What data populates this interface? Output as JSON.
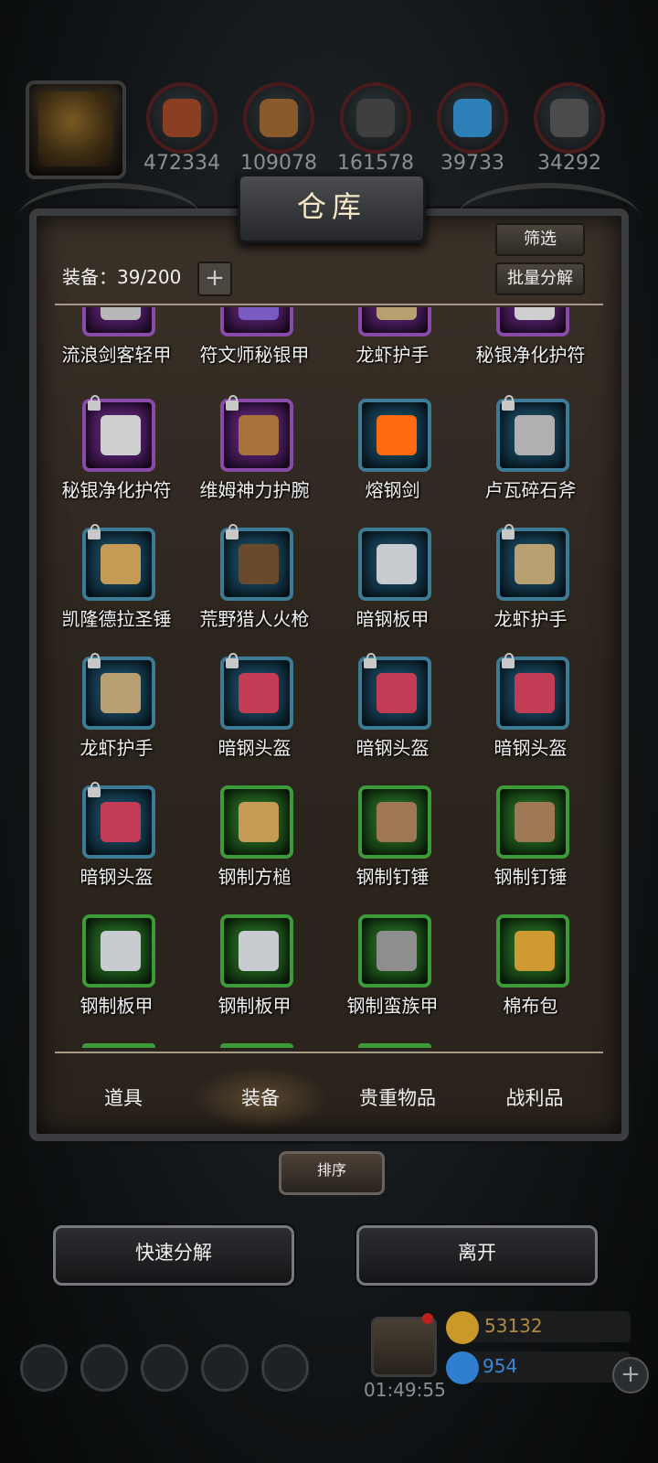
{
  "header": {
    "resources": [
      {
        "icon": "meat-icon",
        "value": "472334"
      },
      {
        "icon": "wood-icon",
        "value": "109078"
      },
      {
        "icon": "stone-icon",
        "value": "161578"
      },
      {
        "icon": "crystal-icon",
        "value": "39733"
      },
      {
        "icon": "iron-icon",
        "value": "34292"
      }
    ]
  },
  "panel": {
    "title": "仓库",
    "capacity_label": "装备：39/200",
    "filter_label": "筛选",
    "batch_label": "批量分解"
  },
  "items": [
    {
      "name": "流浪剑客轻甲",
      "rarity": "purple",
      "locked": false,
      "row": 0,
      "col": 0,
      "color": "#b8b8b8"
    },
    {
      "name": "符文师秘银甲",
      "rarity": "purple",
      "locked": false,
      "row": 0,
      "col": 1,
      "color": "#7a5bc4"
    },
    {
      "name": "龙虾护手",
      "rarity": "purple",
      "locked": false,
      "row": 0,
      "col": 2,
      "color": "#b8a070"
    },
    {
      "name": "秘银净化护符",
      "rarity": "purple",
      "locked": false,
      "row": 0,
      "col": 3,
      "color": "#cfcfcf"
    },
    {
      "name": "秘银净化护符",
      "rarity": "purple",
      "locked": true,
      "row": 1,
      "col": 0,
      "color": "#cfcfcf"
    },
    {
      "name": "维姆神力护腕",
      "rarity": "purple",
      "locked": true,
      "row": 1,
      "col": 1,
      "color": "#a8733a"
    },
    {
      "name": "熔钢剑",
      "rarity": "blue",
      "locked": false,
      "row": 1,
      "col": 2,
      "color": "#ff6a12"
    },
    {
      "name": "卢瓦碎石斧",
      "rarity": "blue",
      "locked": true,
      "row": 1,
      "col": 3,
      "color": "#b0b0b0"
    },
    {
      "name": "凯隆德拉圣锤",
      "rarity": "blue",
      "locked": true,
      "row": 2,
      "col": 0,
      "color": "#c49a55"
    },
    {
      "name": "荒野猎人火枪",
      "rarity": "blue",
      "locked": true,
      "row": 2,
      "col": 1,
      "color": "#6a4a2d"
    },
    {
      "name": "暗钢板甲",
      "rarity": "blue",
      "locked": false,
      "row": 2,
      "col": 2,
      "color": "#c8ccd0"
    },
    {
      "name": "龙虾护手",
      "rarity": "blue",
      "locked": true,
      "row": 2,
      "col": 3,
      "color": "#b8a070"
    },
    {
      "name": "龙虾护手",
      "rarity": "blue",
      "locked": true,
      "row": 3,
      "col": 0,
      "color": "#b8a070"
    },
    {
      "name": "暗钢头盔",
      "rarity": "blue",
      "locked": true,
      "row": 3,
      "col": 1,
      "color": "#c43b55"
    },
    {
      "name": "暗钢头盔",
      "rarity": "blue",
      "locked": true,
      "row": 3,
      "col": 2,
      "color": "#c43b55"
    },
    {
      "name": "暗钢头盔",
      "rarity": "blue",
      "locked": true,
      "row": 3,
      "col": 3,
      "color": "#c43b55"
    },
    {
      "name": "暗钢头盔",
      "rarity": "blue",
      "locked": true,
      "row": 4,
      "col": 0,
      "color": "#c43b55"
    },
    {
      "name": "钢制方槌",
      "rarity": "green",
      "locked": false,
      "row": 4,
      "col": 1,
      "color": "#c49a55"
    },
    {
      "name": "钢制钉锤",
      "rarity": "green",
      "locked": false,
      "row": 4,
      "col": 2,
      "color": "#a07755"
    },
    {
      "name": "钢制钉锤",
      "rarity": "green",
      "locked": false,
      "row": 4,
      "col": 3,
      "color": "#a07755"
    },
    {
      "name": "钢制板甲",
      "rarity": "green",
      "locked": false,
      "row": 5,
      "col": 0,
      "color": "#c8ccd0"
    },
    {
      "name": "钢制板甲",
      "rarity": "green",
      "locked": false,
      "row": 5,
      "col": 1,
      "color": "#c8ccd0"
    },
    {
      "name": "钢制蛮族甲",
      "rarity": "green",
      "locked": false,
      "row": 5,
      "col": 2,
      "color": "#8e8e8e"
    },
    {
      "name": "棉布包",
      "rarity": "green",
      "locked": false,
      "row": 5,
      "col": 3,
      "color": "#d09a33"
    }
  ],
  "tabs": [
    {
      "label": "道具",
      "active": false
    },
    {
      "label": "装备",
      "active": true
    },
    {
      "label": "贵重物品",
      "active": false
    },
    {
      "label": "战利品",
      "active": false
    }
  ],
  "sort_label": "排序",
  "actions": {
    "quick_decompose": "快速分解",
    "leave": "离开"
  },
  "footer": {
    "timer": "01:49:55",
    "gold": "53132",
    "gems": "954"
  }
}
